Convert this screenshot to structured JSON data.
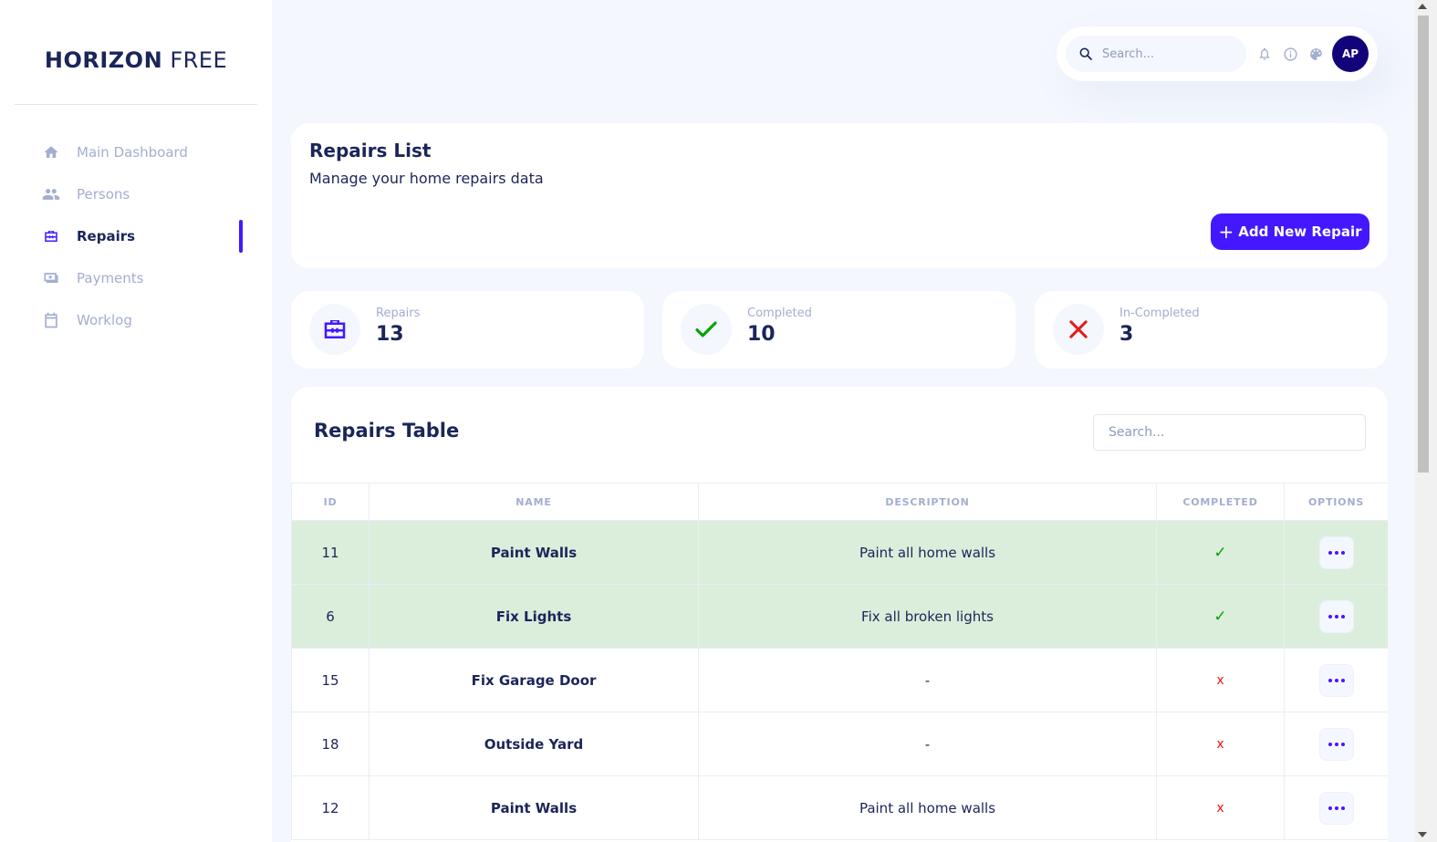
{
  "brand": {
    "bold": "HORIZON",
    "light": "FREE"
  },
  "sidebar": {
    "items": [
      {
        "label": "Main Dashboard",
        "icon": "home-icon",
        "active": false
      },
      {
        "label": "Persons",
        "icon": "people-icon",
        "active": false
      },
      {
        "label": "Repairs",
        "icon": "toolbox-icon",
        "active": true
      },
      {
        "label": "Payments",
        "icon": "money-icon",
        "active": false
      },
      {
        "label": "Worklog",
        "icon": "calendar-icon",
        "active": false
      }
    ]
  },
  "topbar": {
    "search_placeholder": "Search...",
    "icons": [
      "bell-icon",
      "info-icon",
      "palette-icon"
    ],
    "avatar_initials": "AP"
  },
  "header": {
    "title": "Repairs List",
    "subtitle": "Manage your home repairs data",
    "add_button_label": "Add New Repair"
  },
  "stats": [
    {
      "label": "Repairs",
      "value": "13",
      "icon": "toolbox-icon"
    },
    {
      "label": "Completed",
      "value": "10",
      "icon": "check-icon"
    },
    {
      "label": "In-Completed",
      "value": "3",
      "icon": "x-icon"
    }
  ],
  "table": {
    "title": "Repairs Table",
    "search_placeholder": "Search...",
    "columns": [
      "ID",
      "NAME",
      "DESCRIPTION",
      "COMPLETED",
      "OPTIONS"
    ],
    "rows": [
      {
        "id": "11",
        "name": "Paint Walls",
        "description": "Paint all home walls",
        "completed": "✓",
        "done": true
      },
      {
        "id": "6",
        "name": "Fix Lights",
        "description": "Fix all broken lights",
        "completed": "✓",
        "done": true
      },
      {
        "id": "15",
        "name": "Fix Garage Door",
        "description": "-",
        "completed": "x",
        "done": false
      },
      {
        "id": "18",
        "name": "Outside Yard",
        "description": "-",
        "completed": "x",
        "done": false
      },
      {
        "id": "12",
        "name": "Paint Walls",
        "description": "Paint all home walls",
        "completed": "x",
        "done": false
      }
    ]
  },
  "colors": {
    "accent": "#4318ff",
    "navy": "#1b2559",
    "muted": "#a3aed0",
    "completed_row_bg": "#dbeedb",
    "check_green": "#05a10b",
    "cross_red": "#e31a1a",
    "avatar_bg": "#11047a"
  }
}
